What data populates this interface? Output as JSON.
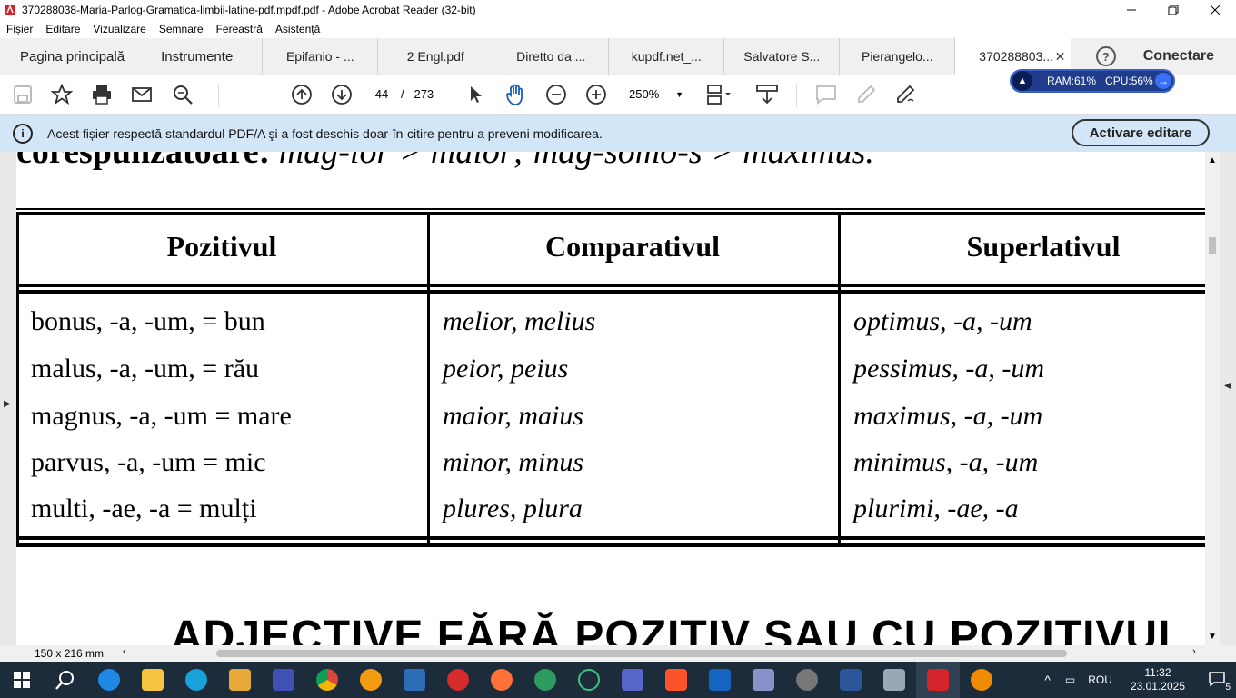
{
  "window": {
    "title": "370288038-Maria-Parlog-Gramatica-limbii-latine-pdf.mpdf.pdf - Adobe Acrobat Reader (32-bit)"
  },
  "menu": [
    "Fișier",
    "Editare",
    "Vizualizare",
    "Semnare",
    "Fereastră",
    "Asistență"
  ],
  "tabs": {
    "home": "Pagina principală",
    "tools": "Instrumente",
    "documents": [
      "Epifanio - ...",
      "2 Engl.pdf",
      "Diretto da ...",
      "kupdf.net_...",
      "Salvatore S...",
      "Pierangelo...",
      "370288803..."
    ],
    "help": "?",
    "connect": "Conectare"
  },
  "toolbar": {
    "page_current": "44",
    "page_separator": "/",
    "page_total": "273",
    "zoom": "250%"
  },
  "monitor": {
    "ram": "RAM:61%",
    "cpu": "CPU:56%"
  },
  "notice": {
    "info_icon": "i",
    "text": "Acest fișier respectă standardul PDF/A şi a fost deschis doar-în-citire pentru a preveni modificarea.",
    "button": "Activare editare"
  },
  "document": {
    "cut_text_plain": "corespunzătoare: ",
    "cut_text_italic": "mag-ior > maior; mag-somo-s > maximus.",
    "table": {
      "headers": [
        "Pozitivul",
        "Comparativul",
        "Superlativul"
      ],
      "rows": [
        [
          "bonus, -a, -um, = bun",
          "melior, melius",
          "optimus, -a, -um"
        ],
        [
          "malus, -a, -um, = rău",
          "peior, peius",
          "pessimus, -a, -um"
        ],
        [
          "magnus, -a, -um = mare",
          "maior, maius",
          "maximus, -a, -um"
        ],
        [
          "parvus, -a, -um = mic",
          "minor, minus",
          "minimus, -a, -um"
        ],
        [
          "multi, -ae, -a = mulți",
          "plures, plura",
          "plurimi, -ae, -a"
        ]
      ]
    },
    "heading": "ADJECTIVE FĂRĂ POZITIV SAU CU POZITIVUL"
  },
  "statusbar": {
    "page_size": "150 x 216 mm"
  },
  "taskbar": {
    "lang": "ROU",
    "time": "11:32",
    "date": "23.01.2025",
    "notif_count": "5"
  }
}
